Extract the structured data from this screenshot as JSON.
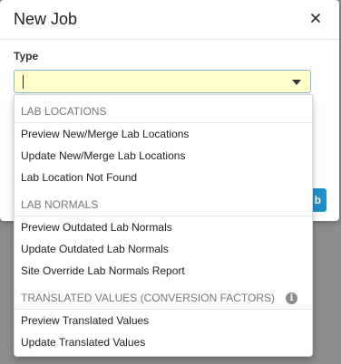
{
  "modal": {
    "title": "New Job",
    "close_icon": "close-icon",
    "type_label": "Type",
    "type_value": "",
    "submit_label": "b"
  },
  "dropdown": {
    "groups": [
      {
        "header": "LAB LOCATIONS",
        "options": [
          "Preview New/Merge Lab Locations",
          "Update New/Merge Lab Locations",
          "Lab Location Not Found"
        ]
      },
      {
        "header": "LAB NORMALS",
        "options": [
          "Preview Outdated Lab Normals",
          "Update Outdated Lab Normals",
          "Site Override Lab Normals Report"
        ]
      },
      {
        "header": "TRANSLATED VALUES (CONVERSION FACTORS)",
        "info_icon": "info-icon",
        "options": [
          "Preview Translated Values",
          "Update Translated Values"
        ]
      }
    ]
  },
  "colors": {
    "select_bg": "#ffffcc",
    "select_border": "#8fb7d6",
    "primary": "#1f8ecb",
    "backdrop": "#8c8c8c"
  }
}
